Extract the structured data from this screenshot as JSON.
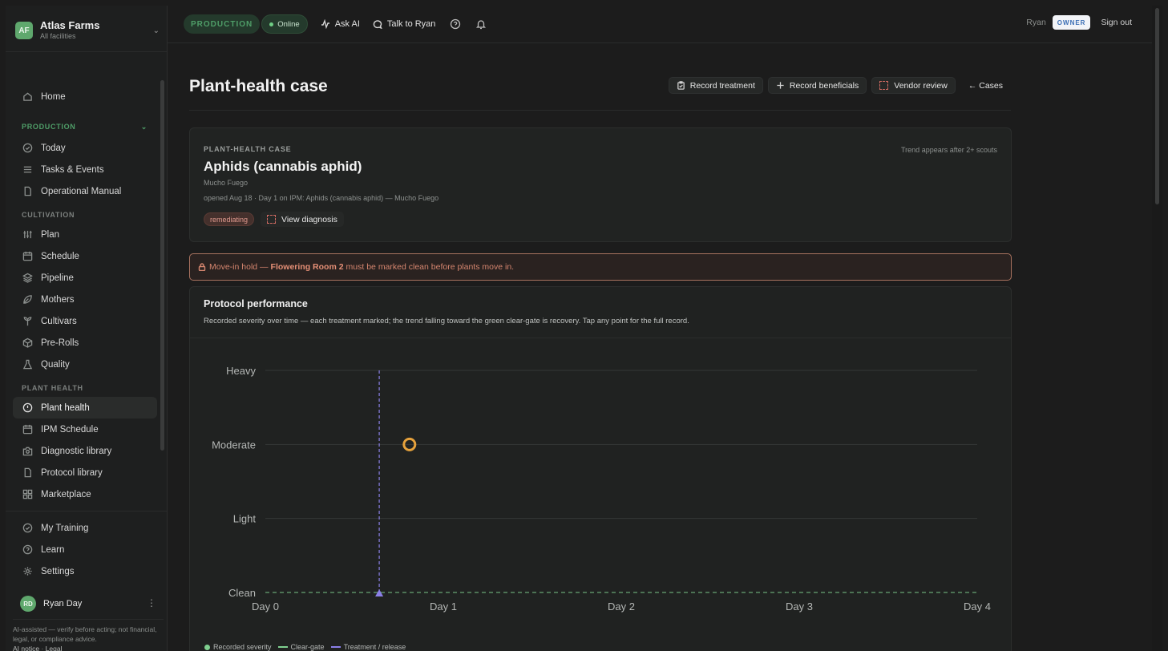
{
  "brand": {
    "initials": "AF",
    "name": "Atlas Farms",
    "sub": "All facilities"
  },
  "sidebar": {
    "home": "Home",
    "production_section": "PRODUCTION",
    "production_items": [
      "Today",
      "Tasks & Events",
      "Operational Manual"
    ],
    "cultivation_section": "CULTIVATION",
    "cultivation_items": [
      "Plan",
      "Schedule",
      "Pipeline",
      "Mothers",
      "Cultivars",
      "Pre-Rolls",
      "Quality"
    ],
    "plant_health_section": "PLANT HEALTH",
    "plant_health_items": [
      "Plant health",
      "IPM Schedule",
      "Diagnostic library",
      "Protocol library",
      "Marketplace"
    ],
    "bottom_items": [
      "My Training",
      "Learn",
      "Settings"
    ],
    "user": {
      "initials": "RD",
      "name": "Ryan Day"
    },
    "ai_note": "AI-assisted — verify before acting; not financial, legal, or compliance advice.",
    "ai_notice_link": "AI notice",
    "legal_link": "Legal",
    "separator": "·"
  },
  "topbar": {
    "env": "PRODUCTION",
    "status": "Online",
    "ask_ai": "Ask AI",
    "talk": "Talk to Ryan",
    "user": "Ryan",
    "role": "OWNER",
    "sign_out": "Sign out"
  },
  "page": {
    "title": "Plant-health case",
    "actions": [
      "Record treatment",
      "Record beneficials",
      "Vendor review",
      "← Cases"
    ]
  },
  "case": {
    "kicker": "PLANT-HEALTH CASE",
    "trend_note": "Trend appears after 2+ scouts",
    "title": "Aphids (cannabis aphid)",
    "farm": "Mucho Fuego",
    "meta": "opened Aug 18 · Day 1 on IPM: Aphids (cannabis aphid) — Mucho Fuego",
    "status": "remediating",
    "view_diagnosis": "View diagnosis"
  },
  "hold": {
    "prefix": "Move-in hold —",
    "room": "Flowering Room 2",
    "suffix": "must be marked clean before plants move in."
  },
  "performance": {
    "title": "Protocol performance",
    "description": "Recorded severity over time — each treatment marked; the trend falling toward the green clear-gate is recovery. Tap any point for the full record."
  },
  "chart_data": {
    "type": "scatter",
    "x_ticks": [
      "Day 0",
      "Day 1",
      "Day 2",
      "Day 3",
      "Day 4"
    ],
    "y_categories": [
      "Clean",
      "Light",
      "Moderate",
      "Heavy"
    ],
    "xlim": [
      0,
      4
    ],
    "grid": true,
    "series": [
      {
        "name": "Recorded severity",
        "points": [
          {
            "x": 0.81,
            "y": "Moderate"
          }
        ],
        "color": "#e6a23c"
      }
    ],
    "clear_gate": {
      "name": "Clear-gate",
      "y": "Clean",
      "color": "#7fd08f"
    },
    "treatments": [
      {
        "name": "Treatment / release",
        "x": 0.64,
        "color": "#8b80e8"
      }
    ],
    "legend": [
      "Recorded severity",
      "Clear-gate",
      "Treatment / release"
    ],
    "legend_position": "bottom-left"
  }
}
